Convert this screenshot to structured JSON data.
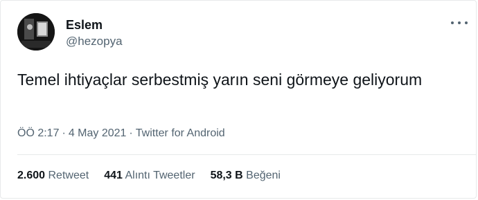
{
  "author": {
    "name": "Eslem",
    "handle": "@hezopya"
  },
  "tweet": {
    "text": "Temel ihtiyaçlar serbestmiş yarın seni görmeye geliyorum"
  },
  "meta": {
    "time": "ÖÖ 2:17",
    "date": "4 May 2021",
    "source": "Twitter for Android",
    "separator": "·"
  },
  "stats": [
    {
      "value": "2.600",
      "label": "Retweet"
    },
    {
      "value": "441",
      "label": "Alıntı Tweetler"
    },
    {
      "value": "58,3 B",
      "label": "Beğeni"
    }
  ],
  "icons": {
    "more": "more-horizontal-icon",
    "avatar": "profile-avatar"
  },
  "colors": {
    "text": "#0f1419",
    "secondary": "#536471",
    "border": "#e7e9ea"
  }
}
